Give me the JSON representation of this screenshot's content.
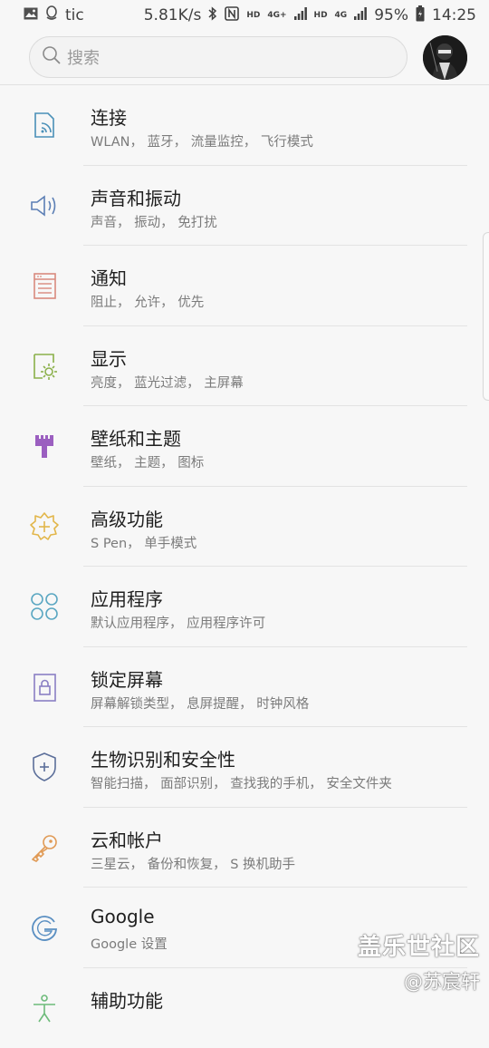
{
  "status_bar": {
    "app_label": "tic",
    "net_speed": "5.81K/s",
    "hd1": "HD",
    "net1": "4G+",
    "hd2": "HD",
    "net2": "4G",
    "battery": "95%",
    "time": "14:25"
  },
  "search": {
    "placeholder": "搜索"
  },
  "settings": [
    {
      "title": "连接",
      "subtitle": "WLAN， 蓝牙， 流量监控， 飞行模式",
      "icon": "connection-icon",
      "color": "#4a90b8"
    },
    {
      "title": "声音和振动",
      "subtitle": "声音， 振动， 免打扰",
      "icon": "speaker-icon",
      "color": "#5c7fb5"
    },
    {
      "title": "通知",
      "subtitle": "阻止， 允许， 优先",
      "icon": "notification-icon",
      "color": "#d98a7e"
    },
    {
      "title": "显示",
      "subtitle": "亮度， 蓝光过滤， 主屏幕",
      "icon": "display-icon",
      "color": "#8bb04a"
    },
    {
      "title": "壁纸和主题",
      "subtitle": "壁纸， 主题， 图标",
      "icon": "paintbrush-icon",
      "color": "#9b5fc0"
    },
    {
      "title": "高级功能",
      "subtitle": "S Pen， 单手模式",
      "icon": "gear-plus-icon",
      "color": "#e2b64a"
    },
    {
      "title": "应用程序",
      "subtitle": "默认应用程序， 应用程序许可",
      "icon": "apps-icon",
      "color": "#5ba7c2"
    },
    {
      "title": "锁定屏幕",
      "subtitle": "屏幕解锁类型， 息屏提醒， 时钟风格",
      "icon": "lock-icon",
      "color": "#8a7fc4"
    },
    {
      "title": "生物识别和安全性",
      "subtitle": "智能扫描， 面部识别， 查找我的手机， 安全文件夹",
      "icon": "shield-icon",
      "color": "#5c6f9a"
    },
    {
      "title": "云和帐户",
      "subtitle": "三星云， 备份和恢复， S 换机助手",
      "icon": "key-icon",
      "color": "#e09a55"
    },
    {
      "title": "Google",
      "subtitle": "Google 设置",
      "icon": "google-icon",
      "color": "#5a8fc2"
    },
    {
      "title": "辅助功能",
      "subtitle": "",
      "icon": "accessibility-icon",
      "color": "#6dbb7a"
    }
  ],
  "watermark": {
    "line1": "盖乐世社区",
    "line2": "@苏宸轩"
  }
}
